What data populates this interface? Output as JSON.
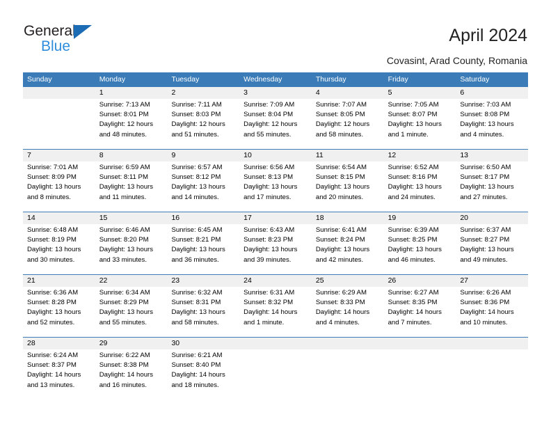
{
  "brand": {
    "name_top": "General",
    "name_bottom": "Blue",
    "triangle_icon": "triangle-right-icon",
    "accent_blue": "#1b6cb5",
    "light_blue": "#2f8ddc"
  },
  "header": {
    "title": "April 2024",
    "subtitle": "Covasint, Arad County, Romania"
  },
  "calendar": {
    "header_bg": "#3b7cb8",
    "daynumber_bg": "#f0f0f0",
    "weekdays": [
      "Sunday",
      "Monday",
      "Tuesday",
      "Wednesday",
      "Thursday",
      "Friday",
      "Saturday"
    ],
    "weeks": [
      {
        "days": [
          {
            "number": "",
            "sunrise": "",
            "sunset": "",
            "daylight_1": "",
            "daylight_2": ""
          },
          {
            "number": "1",
            "sunrise": "Sunrise: 7:13 AM",
            "sunset": "Sunset: 8:01 PM",
            "daylight_1": "Daylight: 12 hours",
            "daylight_2": "and 48 minutes."
          },
          {
            "number": "2",
            "sunrise": "Sunrise: 7:11 AM",
            "sunset": "Sunset: 8:03 PM",
            "daylight_1": "Daylight: 12 hours",
            "daylight_2": "and 51 minutes."
          },
          {
            "number": "3",
            "sunrise": "Sunrise: 7:09 AM",
            "sunset": "Sunset: 8:04 PM",
            "daylight_1": "Daylight: 12 hours",
            "daylight_2": "and 55 minutes."
          },
          {
            "number": "4",
            "sunrise": "Sunrise: 7:07 AM",
            "sunset": "Sunset: 8:05 PM",
            "daylight_1": "Daylight: 12 hours",
            "daylight_2": "and 58 minutes."
          },
          {
            "number": "5",
            "sunrise": "Sunrise: 7:05 AM",
            "sunset": "Sunset: 8:07 PM",
            "daylight_1": "Daylight: 13 hours",
            "daylight_2": "and 1 minute."
          },
          {
            "number": "6",
            "sunrise": "Sunrise: 7:03 AM",
            "sunset": "Sunset: 8:08 PM",
            "daylight_1": "Daylight: 13 hours",
            "daylight_2": "and 4 minutes."
          }
        ]
      },
      {
        "days": [
          {
            "number": "7",
            "sunrise": "Sunrise: 7:01 AM",
            "sunset": "Sunset: 8:09 PM",
            "daylight_1": "Daylight: 13 hours",
            "daylight_2": "and 8 minutes."
          },
          {
            "number": "8",
            "sunrise": "Sunrise: 6:59 AM",
            "sunset": "Sunset: 8:11 PM",
            "daylight_1": "Daylight: 13 hours",
            "daylight_2": "and 11 minutes."
          },
          {
            "number": "9",
            "sunrise": "Sunrise: 6:57 AM",
            "sunset": "Sunset: 8:12 PM",
            "daylight_1": "Daylight: 13 hours",
            "daylight_2": "and 14 minutes."
          },
          {
            "number": "10",
            "sunrise": "Sunrise: 6:56 AM",
            "sunset": "Sunset: 8:13 PM",
            "daylight_1": "Daylight: 13 hours",
            "daylight_2": "and 17 minutes."
          },
          {
            "number": "11",
            "sunrise": "Sunrise: 6:54 AM",
            "sunset": "Sunset: 8:15 PM",
            "daylight_1": "Daylight: 13 hours",
            "daylight_2": "and 20 minutes."
          },
          {
            "number": "12",
            "sunrise": "Sunrise: 6:52 AM",
            "sunset": "Sunset: 8:16 PM",
            "daylight_1": "Daylight: 13 hours",
            "daylight_2": "and 24 minutes."
          },
          {
            "number": "13",
            "sunrise": "Sunrise: 6:50 AM",
            "sunset": "Sunset: 8:17 PM",
            "daylight_1": "Daylight: 13 hours",
            "daylight_2": "and 27 minutes."
          }
        ]
      },
      {
        "days": [
          {
            "number": "14",
            "sunrise": "Sunrise: 6:48 AM",
            "sunset": "Sunset: 8:19 PM",
            "daylight_1": "Daylight: 13 hours",
            "daylight_2": "and 30 minutes."
          },
          {
            "number": "15",
            "sunrise": "Sunrise: 6:46 AM",
            "sunset": "Sunset: 8:20 PM",
            "daylight_1": "Daylight: 13 hours",
            "daylight_2": "and 33 minutes."
          },
          {
            "number": "16",
            "sunrise": "Sunrise: 6:45 AM",
            "sunset": "Sunset: 8:21 PM",
            "daylight_1": "Daylight: 13 hours",
            "daylight_2": "and 36 minutes."
          },
          {
            "number": "17",
            "sunrise": "Sunrise: 6:43 AM",
            "sunset": "Sunset: 8:23 PM",
            "daylight_1": "Daylight: 13 hours",
            "daylight_2": "and 39 minutes."
          },
          {
            "number": "18",
            "sunrise": "Sunrise: 6:41 AM",
            "sunset": "Sunset: 8:24 PM",
            "daylight_1": "Daylight: 13 hours",
            "daylight_2": "and 42 minutes."
          },
          {
            "number": "19",
            "sunrise": "Sunrise: 6:39 AM",
            "sunset": "Sunset: 8:25 PM",
            "daylight_1": "Daylight: 13 hours",
            "daylight_2": "and 46 minutes."
          },
          {
            "number": "20",
            "sunrise": "Sunrise: 6:37 AM",
            "sunset": "Sunset: 8:27 PM",
            "daylight_1": "Daylight: 13 hours",
            "daylight_2": "and 49 minutes."
          }
        ]
      },
      {
        "days": [
          {
            "number": "21",
            "sunrise": "Sunrise: 6:36 AM",
            "sunset": "Sunset: 8:28 PM",
            "daylight_1": "Daylight: 13 hours",
            "daylight_2": "and 52 minutes."
          },
          {
            "number": "22",
            "sunrise": "Sunrise: 6:34 AM",
            "sunset": "Sunset: 8:29 PM",
            "daylight_1": "Daylight: 13 hours",
            "daylight_2": "and 55 minutes."
          },
          {
            "number": "23",
            "sunrise": "Sunrise: 6:32 AM",
            "sunset": "Sunset: 8:31 PM",
            "daylight_1": "Daylight: 13 hours",
            "daylight_2": "and 58 minutes."
          },
          {
            "number": "24",
            "sunrise": "Sunrise: 6:31 AM",
            "sunset": "Sunset: 8:32 PM",
            "daylight_1": "Daylight: 14 hours",
            "daylight_2": "and 1 minute."
          },
          {
            "number": "25",
            "sunrise": "Sunrise: 6:29 AM",
            "sunset": "Sunset: 8:33 PM",
            "daylight_1": "Daylight: 14 hours",
            "daylight_2": "and 4 minutes."
          },
          {
            "number": "26",
            "sunrise": "Sunrise: 6:27 AM",
            "sunset": "Sunset: 8:35 PM",
            "daylight_1": "Daylight: 14 hours",
            "daylight_2": "and 7 minutes."
          },
          {
            "number": "27",
            "sunrise": "Sunrise: 6:26 AM",
            "sunset": "Sunset: 8:36 PM",
            "daylight_1": "Daylight: 14 hours",
            "daylight_2": "and 10 minutes."
          }
        ]
      },
      {
        "days": [
          {
            "number": "28",
            "sunrise": "Sunrise: 6:24 AM",
            "sunset": "Sunset: 8:37 PM",
            "daylight_1": "Daylight: 14 hours",
            "daylight_2": "and 13 minutes."
          },
          {
            "number": "29",
            "sunrise": "Sunrise: 6:22 AM",
            "sunset": "Sunset: 8:38 PM",
            "daylight_1": "Daylight: 14 hours",
            "daylight_2": "and 16 minutes."
          },
          {
            "number": "30",
            "sunrise": "Sunrise: 6:21 AM",
            "sunset": "Sunset: 8:40 PM",
            "daylight_1": "Daylight: 14 hours",
            "daylight_2": "and 18 minutes."
          },
          {
            "number": "",
            "sunrise": "",
            "sunset": "",
            "daylight_1": "",
            "daylight_2": ""
          },
          {
            "number": "",
            "sunrise": "",
            "sunset": "",
            "daylight_1": "",
            "daylight_2": ""
          },
          {
            "number": "",
            "sunrise": "",
            "sunset": "",
            "daylight_1": "",
            "daylight_2": ""
          },
          {
            "number": "",
            "sunrise": "",
            "sunset": "",
            "daylight_1": "",
            "daylight_2": ""
          }
        ]
      }
    ]
  }
}
